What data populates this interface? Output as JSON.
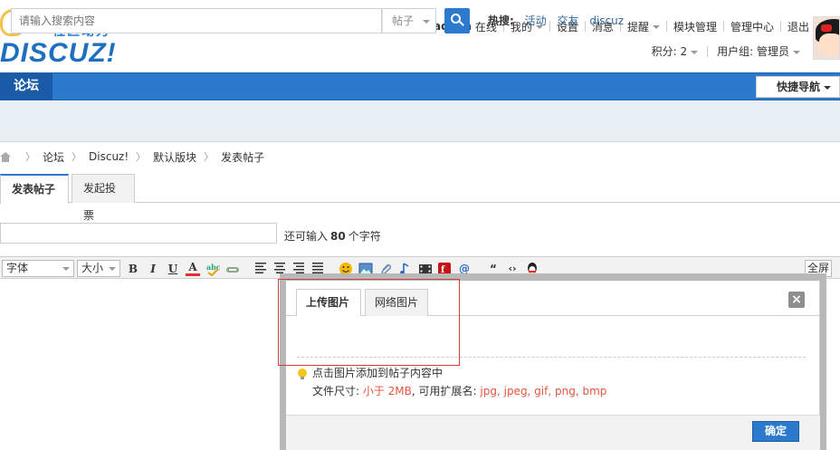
{
  "logo": {
    "slogan": "社区动力",
    "word": "DISCUZ!"
  },
  "usermenu": {
    "username": "admin",
    "status": "在线",
    "items": [
      {
        "label": "我的",
        "dropdown": true
      },
      {
        "label": "设置"
      },
      {
        "label": "消息"
      },
      {
        "label": "提醒",
        "dropdown": true
      },
      {
        "label": "模块管理"
      },
      {
        "label": "管理中心"
      },
      {
        "label": "退出"
      }
    ],
    "credits": "积分: 2",
    "usergroup": "用户组: 管理员"
  },
  "nav": {
    "forum": "论坛",
    "quicknav": "快捷导航"
  },
  "search": {
    "placeholder": "请输入搜索内容",
    "type": "帖子",
    "hot_label": "热搜:",
    "hot_words": [
      "活动",
      "交友",
      "discuz"
    ]
  },
  "breadcrumb": [
    "论坛",
    "Discuz!",
    "默认版块",
    "发表帖子"
  ],
  "post_tabs": [
    "发表帖子",
    "发起投票"
  ],
  "subject": {
    "value": "",
    "remain_prefix": "还可输入",
    "remain_count": "80",
    "remain_suffix": "个字符"
  },
  "toolbar": {
    "font": "字体",
    "size": "大小",
    "bold": "B",
    "italic": "I",
    "underline": "U",
    "text_color": "A",
    "fullscreen": "全屏"
  },
  "dialog": {
    "tabs": [
      "上传图片",
      "网络图片"
    ],
    "close": "×",
    "tip": "点击图片添加到帖子内容中",
    "limits_label": "文件尺寸: ",
    "limits_size": "小于 2MB",
    "limits_ext_label": ", 可用扩展名: ",
    "limits_ext": "jpg, jpeg, gif, png, bmp",
    "ok": "确定"
  },
  "colors": {
    "accent": "#2b7acd",
    "link": "#336699",
    "warning": "#e5553e",
    "highlight": "#d93a3a"
  }
}
